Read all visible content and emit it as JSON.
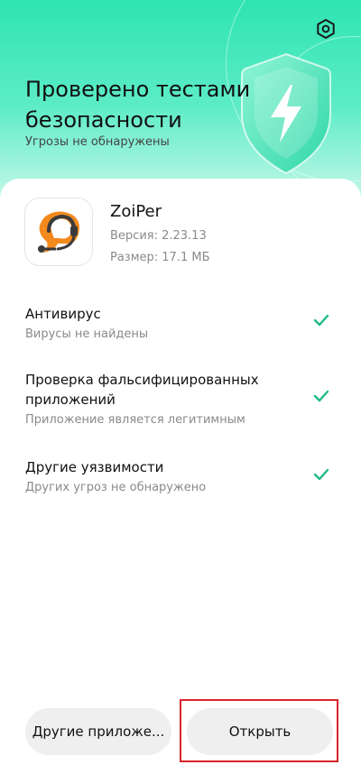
{
  "header": {
    "title": "Проверено тестами безопасности",
    "subtitle": "Угрозы не обнаружены",
    "settings_icon": "settings-hex-icon",
    "shield_icon": "shield-lightning-icon"
  },
  "app": {
    "name": "ZoiPer",
    "version": "Версия: 2.23.13",
    "size": "Размер: 17.1 МБ",
    "icon": "zoiper-headset-icon"
  },
  "checks": [
    {
      "title": "Антивирус",
      "subtitle": "Вирусы не найдены",
      "status": "passed"
    },
    {
      "title": "Проверка фальсифицированных приложений",
      "subtitle": "Приложение является легитимным",
      "status": "passed"
    },
    {
      "title": "Другие уязвимости",
      "subtitle": "Других угроз не обнаружено",
      "status": "passed"
    }
  ],
  "buttons": {
    "other": "Другие приложе...",
    "open": "Открыть"
  },
  "colors": {
    "accent": "#2fe4b2",
    "check": "#1fb987",
    "highlight": "#d9242b"
  }
}
